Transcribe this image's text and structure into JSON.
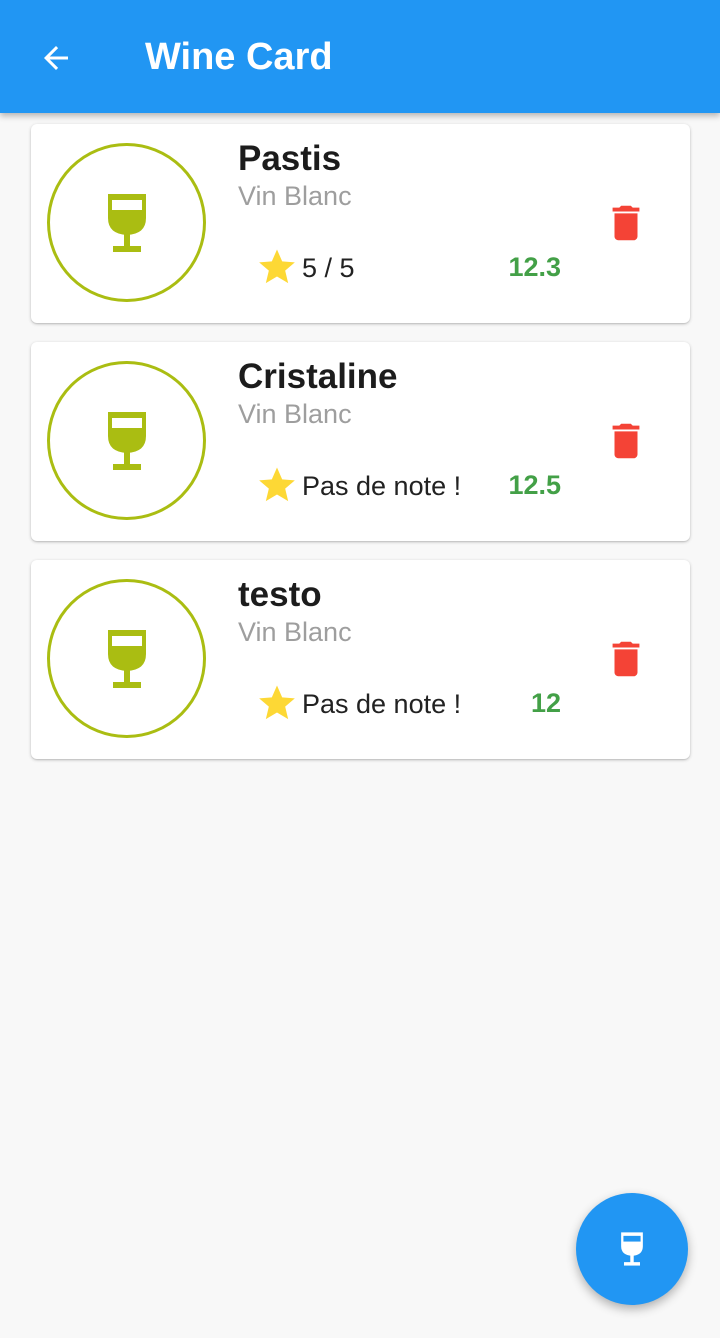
{
  "app_bar": {
    "title": "Wine Card",
    "back_icon": "arrow-back-icon",
    "color": "#2196f3"
  },
  "wines": [
    {
      "name": "Pastis",
      "type": "Vin Blanc",
      "rating": "5 / 5",
      "degree": "12.3"
    },
    {
      "name": "Cristaline",
      "type": "Vin Blanc",
      "rating": "Pas de note !",
      "degree": "12.5"
    },
    {
      "name": "testo",
      "type": "Vin Blanc",
      "rating": "Pas de note !",
      "degree": "12"
    }
  ],
  "icons": {
    "avatar": "wine-glass-icon",
    "rating": "star-icon",
    "delete": "trash-icon",
    "fab": "wine-glass-icon"
  },
  "colors": {
    "accent": "#2196f3",
    "glass": "#aabd12",
    "star": "#fdd835",
    "degree": "#43a047",
    "delete": "#f44336"
  }
}
